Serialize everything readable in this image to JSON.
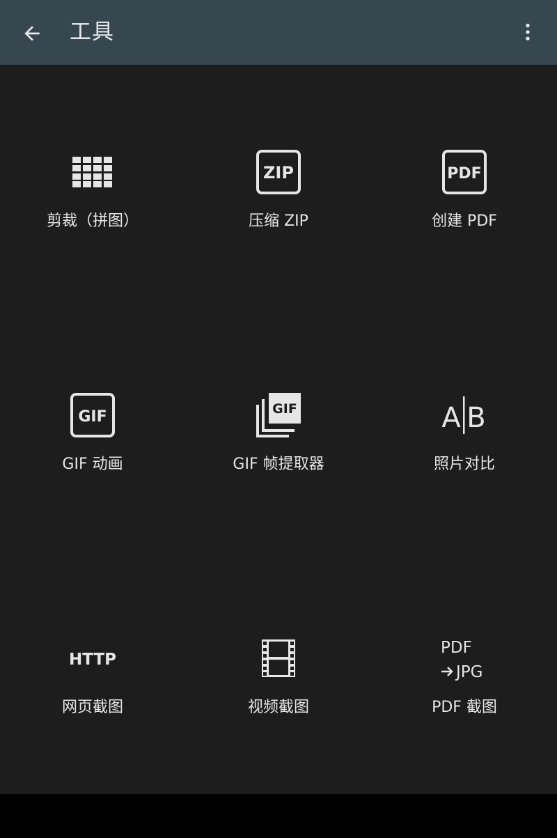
{
  "appbar": {
    "title": "工具",
    "back_icon": "arrow-left-icon",
    "menu_icon": "more-vert-icon"
  },
  "colors": {
    "appbar_bg": "#37474f",
    "content_bg": "#1d1d1d",
    "nav_bg": "#000000",
    "icon": "#e6e6e6",
    "text": "#e6e6e6"
  },
  "tools": [
    {
      "label": "剪裁（拼图）",
      "icon": "grid-icon"
    },
    {
      "label": "压缩 ZIP",
      "icon": "zip-icon",
      "icon_text": "ZIP"
    },
    {
      "label": "创建 PDF",
      "icon": "pdf-icon",
      "icon_text": "PDF"
    },
    {
      "label": "GIF 动画",
      "icon": "gif-icon",
      "icon_text": "GIF"
    },
    {
      "label": "GIF 帧提取器",
      "icon": "gif-frames-icon",
      "icon_text": "GIF"
    },
    {
      "label": "照片对比",
      "icon": "compare-ab-icon",
      "icon_text_a": "A",
      "icon_text_b": "B"
    },
    {
      "label": "网页截图",
      "icon": "http-icon",
      "icon_text": "HTTP"
    },
    {
      "label": "视频截图",
      "icon": "film-icon"
    },
    {
      "label": "PDF 截图",
      "icon": "pdf-to-jpg-icon",
      "icon_text_top": "PDF",
      "icon_text_bottom": "JPG"
    }
  ]
}
